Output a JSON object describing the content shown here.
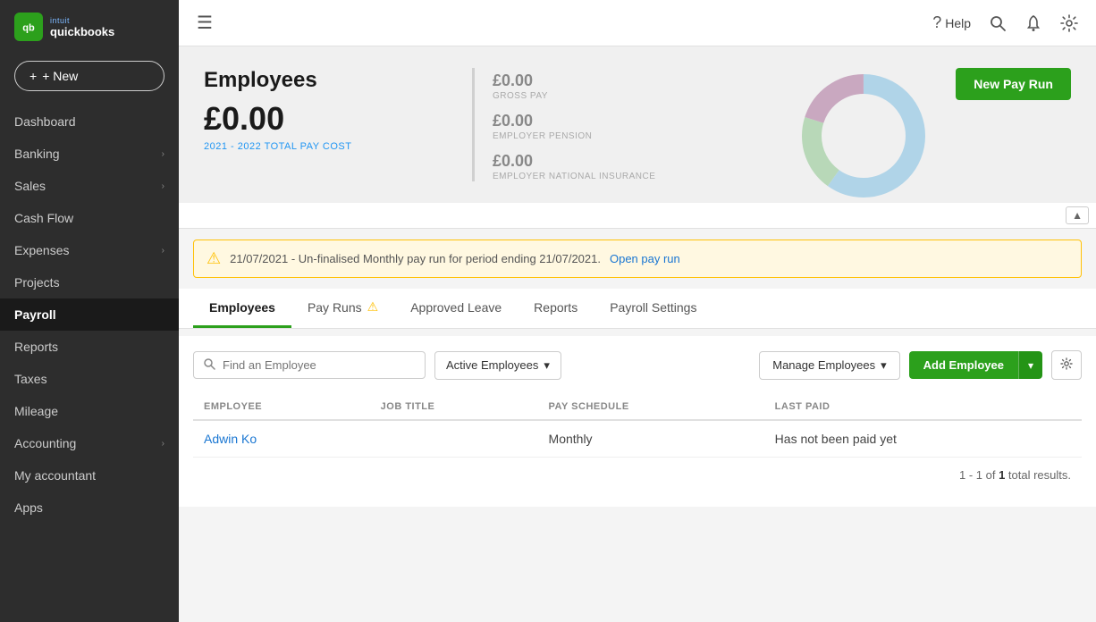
{
  "app": {
    "name": "QuickBooks",
    "logo_abbr": "qb",
    "tagline": "intuit quickbooks"
  },
  "sidebar": {
    "new_button": "+ New",
    "items": [
      {
        "label": "Dashboard",
        "active": false,
        "has_chevron": false
      },
      {
        "label": "Banking",
        "active": false,
        "has_chevron": true
      },
      {
        "label": "Sales",
        "active": false,
        "has_chevron": true
      },
      {
        "label": "Cash Flow",
        "active": false,
        "has_chevron": false
      },
      {
        "label": "Expenses",
        "active": false,
        "has_chevron": true
      },
      {
        "label": "Projects",
        "active": false,
        "has_chevron": false
      },
      {
        "label": "Payroll",
        "active": true,
        "has_chevron": false
      },
      {
        "label": "Reports",
        "active": false,
        "has_chevron": false
      },
      {
        "label": "Taxes",
        "active": false,
        "has_chevron": false
      },
      {
        "label": "Mileage",
        "active": false,
        "has_chevron": false
      },
      {
        "label": "Accounting",
        "active": false,
        "has_chevron": true
      },
      {
        "label": "My accountant",
        "active": false,
        "has_chevron": false
      },
      {
        "label": "Apps",
        "active": false,
        "has_chevron": false
      }
    ]
  },
  "topbar": {
    "menu_icon": "☰",
    "help_label": "Help",
    "search_icon": "🔍",
    "bell_icon": "🔔",
    "settings_icon": "⚙"
  },
  "header": {
    "title": "Employees",
    "amount": "£0.00",
    "subtitle": "2021 - 2022 TOTAL PAY COST",
    "new_pay_run": "New Pay Run",
    "stats": [
      {
        "value": "£0.00",
        "label": "GROSS PAY"
      },
      {
        "value": "£0.00",
        "label": "EMPLOYER PENSION"
      },
      {
        "value": "£0.00",
        "label": "EMPLOYER NATIONAL INSURANCE"
      }
    ],
    "donut": {
      "segments": [
        {
          "color": "#b0d4e8",
          "value": 60
        },
        {
          "color": "#b8d4b8",
          "value": 20
        },
        {
          "color": "#c9a8c0",
          "value": 20
        }
      ]
    }
  },
  "warning": {
    "icon": "⚠",
    "text": "21/07/2021 - Un-finalised Monthly pay run for period ending 21/07/2021.",
    "link_text": "Open pay run"
  },
  "tabs": [
    {
      "label": "Employees",
      "active": true,
      "has_warning": false
    },
    {
      "label": "Pay Runs",
      "active": false,
      "has_warning": true
    },
    {
      "label": "Approved Leave",
      "active": false,
      "has_warning": false
    },
    {
      "label": "Reports",
      "active": false,
      "has_warning": false
    },
    {
      "label": "Payroll Settings",
      "active": false,
      "has_warning": false
    }
  ],
  "filter": {
    "search_placeholder": "Find an Employee",
    "active_filter": "Active Employees",
    "manage_label": "Manage Employees",
    "add_employee_label": "Add Employee"
  },
  "table": {
    "columns": [
      "Employee",
      "Job Title",
      "Pay Schedule",
      "Last Paid"
    ],
    "rows": [
      {
        "employee": "Adwin Ko",
        "job_title": "",
        "pay_schedule": "Monthly",
        "last_paid": "Has not been paid yet"
      }
    ],
    "results_text": "1 - 1 of ",
    "results_bold": "1",
    "results_suffix": " total results."
  }
}
